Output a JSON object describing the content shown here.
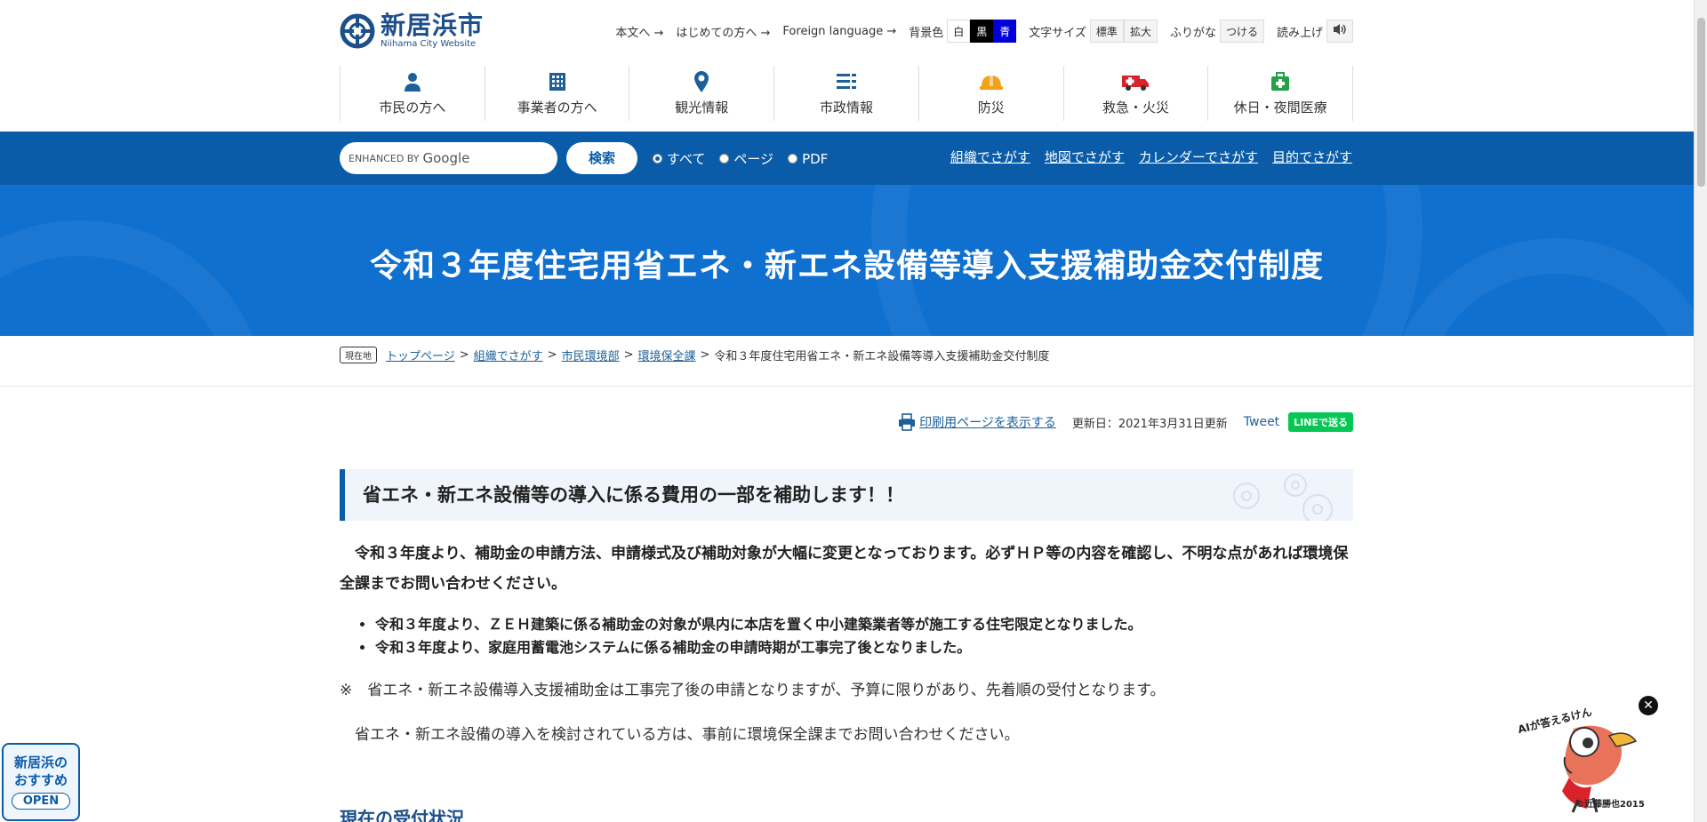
{
  "site": {
    "name": "新居浜市",
    "subtitle": "Niihama City Website"
  },
  "util": {
    "honbun": "本文へ →",
    "hajimete": "はじめての方へ →",
    "foreign": "Foreign language →",
    "bg_label": "背景色",
    "bg_white": "白",
    "bg_black": "黒",
    "bg_blue": "青",
    "size_label": "文字サイズ",
    "size_normal": "標準",
    "size_large": "拡大",
    "furigana_label": "ふりがな",
    "furigana_btn": "つける",
    "read_label": "読み上げ"
  },
  "gnav": [
    {
      "label": "市民の方へ",
      "icon": "person-icon"
    },
    {
      "label": "事業者の方へ",
      "icon": "building-icon"
    },
    {
      "label": "観光情報",
      "icon": "map-pin-icon"
    },
    {
      "label": "市政情報",
      "icon": "list-icon"
    },
    {
      "label": "防災",
      "icon": "helmet-icon"
    },
    {
      "label": "救急・火災",
      "icon": "ambulance-icon"
    },
    {
      "label": "休日・夜間医療",
      "icon": "medical-kit-icon"
    }
  ],
  "search": {
    "placeholder_prefix": "ENHANCED BY",
    "placeholder_brand": "Google",
    "button": "検索",
    "options": [
      "すべて",
      "ページ",
      "PDF"
    ],
    "links": [
      "組織でさがす",
      "地図でさがす",
      "カレンダーでさがす",
      "目的でさがす"
    ]
  },
  "page_title": "令和３年度住宅用省エネ・新エネ設備等導入支援補助金交付制度",
  "breadcrumb": {
    "here": "現在地",
    "items": [
      "トップページ",
      "組織でさがす",
      "市民環境部",
      "環境保全課"
    ],
    "current": "令和３年度住宅用省エネ・新エネ設備等導入支援補助金交付制度",
    "separator": ">"
  },
  "tools": {
    "print": "印刷用ページを表示する",
    "updated": "更新日：2021年3月31日更新",
    "tweet": "Tweet",
    "line": "LINEで送る"
  },
  "content": {
    "heading": "省エネ・新エネ設備等の導入に係る費用の一部を補助します！！",
    "intro": "令和３年度より、補助金の申請方法、申請様式及び補助対象が大幅に変更となっております。必ずＨＰ等の内容を確認し、不明な点があれば環境保全課までお問い合わせください。",
    "bullets": [
      "令和３年度より、ＺＥＨ建築に係る補助金の対象が県内に本店を置く中小建築業者等が施工する住宅限定となりました。",
      "令和３年度より、家庭用蓄電池システムに係る補助金の申請時期が工事完了後となりました。"
    ],
    "note": "※　省エネ・新エネ設備導入支援補助金は工事完了後の申請となりますが、予算に限りがあり、先着順の受付となります。",
    "consult": "省エネ・新エネ設備の導入を検討されている方は、事前に環境保全課までお問い合わせください。",
    "next_heading": "現在の受付状況"
  },
  "floating": {
    "rec_line1": "新居浜の",
    "rec_line2": "おすすめ",
    "rec_open": "OPEN",
    "ai_label": "AIが答えるけん",
    "ai_copy": "©近藤勝也2015"
  },
  "colors": {
    "brand": "#0a5ca8",
    "banner": "#0f70cf",
    "line": "#06c755"
  }
}
